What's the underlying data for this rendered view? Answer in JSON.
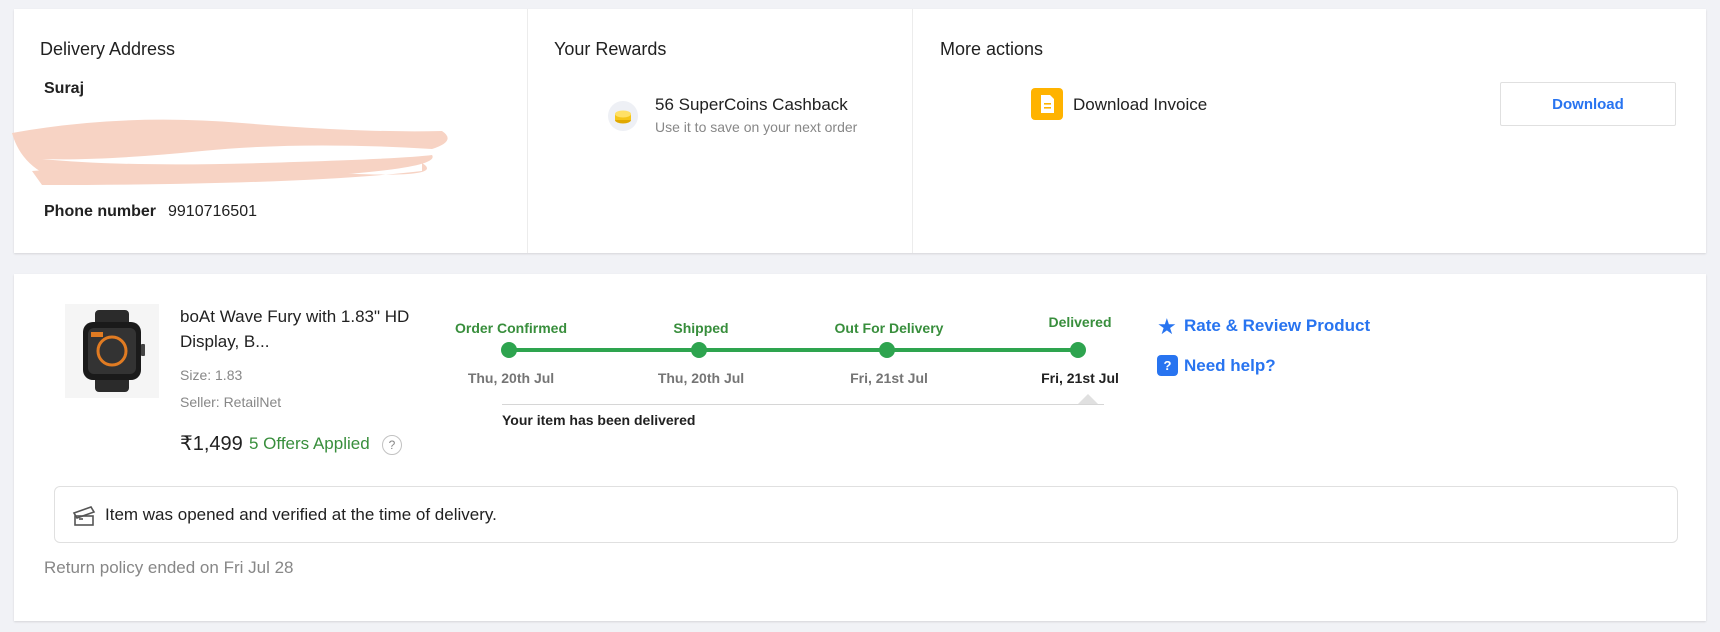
{
  "address": {
    "title": "Delivery Address",
    "name": "Suraj",
    "phone_label": "Phone number",
    "phone_value": "9910716501"
  },
  "rewards": {
    "title": "Your Rewards",
    "main": "56 SuperCoins Cashback",
    "sub": "Use it to save on your next order"
  },
  "actions": {
    "title": "More actions",
    "invoice_label": "Download Invoice",
    "download_button": "Download"
  },
  "product": {
    "title": "boAt Wave Fury with 1.83\" HD Display, B...",
    "size": "Size: 1.83",
    "seller": "Seller: RetailNet",
    "price": "₹1,499",
    "offers": "5 Offers Applied",
    "offers_help": "?"
  },
  "tracker": {
    "steps": [
      {
        "label": "Order Confirmed",
        "date": "Thu, 20th Jul"
      },
      {
        "label": "Shipped",
        "date": "Thu, 20th Jul"
      },
      {
        "label": "Out For Delivery",
        "date": "Fri, 21st Jul"
      },
      {
        "label": "Delivered",
        "date": "Fri, 21st Jul"
      }
    ],
    "message": "Your item has been delivered"
  },
  "links": {
    "rate": "Rate & Review Product",
    "help": "Need help?",
    "help_icon": "?"
  },
  "verified": "Item was opened and verified at the time of delivery.",
  "return_policy": "Return policy ended on Fri Jul 28",
  "colors": {
    "accent_blue": "#2874f0",
    "success_green": "#388e3c",
    "track_green": "#2ea44f",
    "invoice_yellow": "#ffb300"
  }
}
